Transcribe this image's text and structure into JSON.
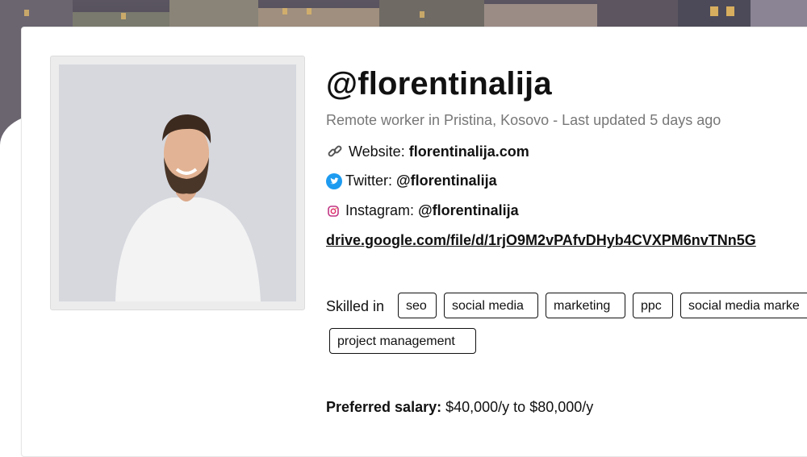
{
  "profile": {
    "handle": "@florentinalija",
    "subtitle": "Remote worker in Pristina, Kosovo - Last updated 5 days ago",
    "website": {
      "label": "Website:",
      "value": "florentinalija.com",
      "icon": "link-icon"
    },
    "twitter": {
      "label": "Twitter:",
      "value": "@florentinalija",
      "icon": "twitter-icon"
    },
    "instagram": {
      "label": "Instagram:",
      "value": "@florentinalija",
      "icon": "instagram-icon"
    },
    "drive_link": "drive.google.com/file/d/1rjO9M2vPAfvDHyb4CVXPM6nvTNn5G",
    "skills_label": "Skilled in",
    "skills": [
      "seo",
      "social media",
      "marketing",
      "ppc",
      "social media marke",
      "project management"
    ],
    "salary": {
      "label": "Preferred salary:",
      "value": "$40,000/y to $80,000/y"
    }
  },
  "colors": {
    "twitter": "#1d9bf0",
    "subtitle": "#777777",
    "card_border": "#e6e6e6"
  }
}
